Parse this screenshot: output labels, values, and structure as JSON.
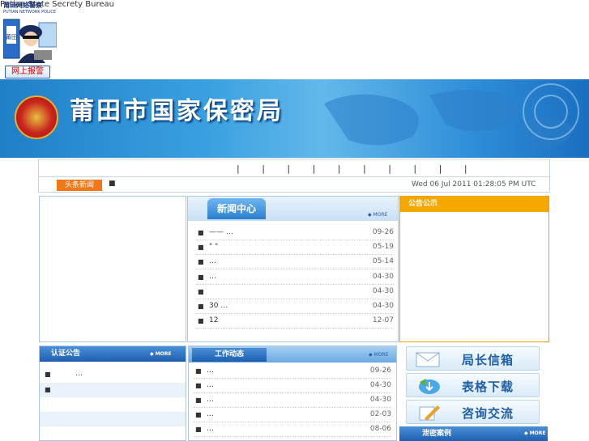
{
  "police": {
    "logo_cn": "莆田网络警察",
    "logo_en": "PUTIAN NETWORK POLICE",
    "badge_cn": "莆田",
    "report_button": "网上报警"
  },
  "banner": {
    "title_cn": "莆田市国家保密局",
    "title_en": "Putian State Secrety Bureau"
  },
  "nav": {
    "separators": "| | | | | | | | | |"
  },
  "ticker": {
    "tag": "头条新闻",
    "bullet": "■",
    "date": "Wed 06 Jul 2011 01:28:05 PM UTC"
  },
  "news": {
    "title": "新闻中心",
    "more": "MORE",
    "items": [
      {
        "text": "——  …",
        "date": "09-26"
      },
      {
        "text": "\" \"",
        "date": "05-19"
      },
      {
        "text": "…",
        "date": "05-14"
      },
      {
        "text": "…",
        "date": "04-30"
      },
      {
        "text": "",
        "date": "04-30"
      },
      {
        "text": "30  …",
        "date": "04-30"
      },
      {
        "text": "12",
        "date": "12-07"
      }
    ]
  },
  "notice": {
    "title": "公告公示"
  },
  "cert": {
    "title": "认证公告",
    "more": "MORE",
    "items": [
      {
        "text": "…"
      },
      {
        "text": ""
      }
    ]
  },
  "work": {
    "title": "工作动态",
    "more": "MORE",
    "items": [
      {
        "text": "…",
        "date": "09-26"
      },
      {
        "text": "…",
        "date": "04-30"
      },
      {
        "text": "…",
        "date": "04-30"
      },
      {
        "text": "…",
        "date": "02-03"
      },
      {
        "text": "…",
        "date": "08-06"
      }
    ]
  },
  "right": {
    "mailbox": "局长信箱",
    "download": "表格下载",
    "consult": "咨询交流"
  },
  "leak": {
    "title": "泄密案例",
    "more": "MORE"
  },
  "colors": {
    "banner_blue": "#2f8ed8",
    "tag_orange": "#f07818",
    "notice_orange": "#f5a800",
    "header_blue": "#1e5fb0"
  }
}
